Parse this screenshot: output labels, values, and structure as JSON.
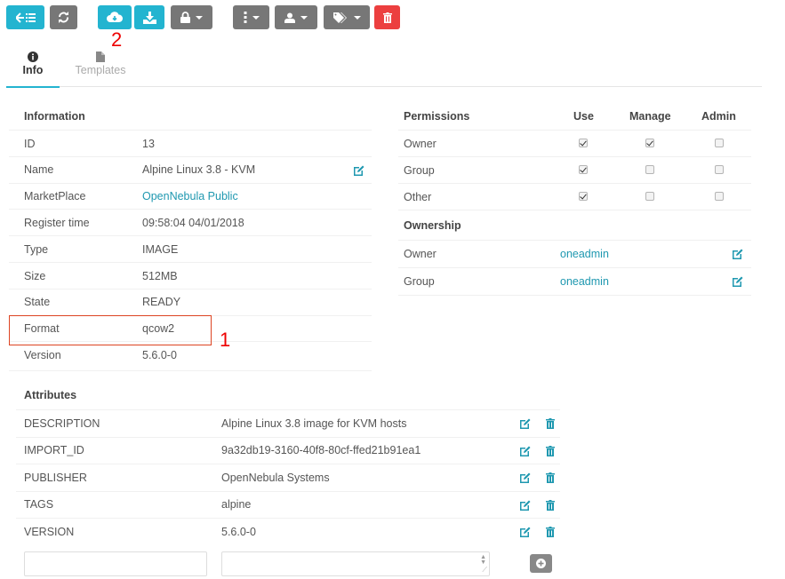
{
  "toolbar": {
    "buttons": [
      {
        "name": "back-to-list",
        "icon": "back-list-icon",
        "color": "#23b4d0"
      },
      {
        "name": "refresh",
        "icon": "refresh-icon",
        "color": "#777777"
      },
      {
        "name": "import",
        "icon": "cloud-download-icon",
        "color": "#23b4d0"
      },
      {
        "name": "download",
        "icon": "download-icon",
        "color": "#23b4d0"
      },
      {
        "name": "lock",
        "icon": "lock-icon",
        "color": "#777777",
        "dropdown": true
      },
      {
        "name": "more-actions",
        "icon": "vertical-ellipsis-icon",
        "color": "#777777",
        "dropdown": true
      },
      {
        "name": "user-actions",
        "icon": "user-icon",
        "color": "#777777",
        "dropdown": true
      },
      {
        "name": "labels",
        "icon": "tags-icon",
        "color": "#777777",
        "dropdown": true
      },
      {
        "name": "delete",
        "icon": "trash-icon",
        "color": "#ec3f3f"
      }
    ]
  },
  "annotations": {
    "marker_1": "1",
    "marker_2": "2"
  },
  "tabs": [
    {
      "label": "Info",
      "icon": "info-circle-icon",
      "active": true
    },
    {
      "label": "Templates",
      "icon": "file-icon",
      "active": false
    }
  ],
  "information": {
    "title": "Information",
    "rows": [
      {
        "label": "ID",
        "value": "13"
      },
      {
        "label": "Name",
        "value": "Alpine Linux 3.8 - KVM",
        "editable": true
      },
      {
        "label": "MarketPlace",
        "value": "OpenNebula Public",
        "link": true
      },
      {
        "label": "Register time",
        "value": "09:58:04 04/01/2018"
      },
      {
        "label": "Type",
        "value": "IMAGE"
      },
      {
        "label": "Size",
        "value": "512MB"
      },
      {
        "label": "State",
        "value": "READY"
      },
      {
        "label": "Format",
        "value": "qcow2"
      },
      {
        "label": "Version",
        "value": "5.6.0-0"
      }
    ]
  },
  "permissions": {
    "title": "Permissions",
    "columns": [
      "Use",
      "Manage",
      "Admin"
    ],
    "rows": [
      {
        "label": "Owner",
        "use": true,
        "manage": true,
        "admin": false
      },
      {
        "label": "Group",
        "use": true,
        "manage": false,
        "admin": false
      },
      {
        "label": "Other",
        "use": true,
        "manage": false,
        "admin": false
      }
    ]
  },
  "ownership": {
    "title": "Ownership",
    "rows": [
      {
        "label": "Owner",
        "value": "oneadmin"
      },
      {
        "label": "Group",
        "value": "oneadmin"
      }
    ]
  },
  "attributes": {
    "title": "Attributes",
    "rows": [
      {
        "key": "DESCRIPTION",
        "value": "Alpine Linux 3.8 image for KVM hosts"
      },
      {
        "key": "IMPORT_ID",
        "value": "9a32db19-3160-40f8-80cf-ffed21b91ea1"
      },
      {
        "key": "PUBLISHER",
        "value": "OpenNebula Systems"
      },
      {
        "key": "TAGS",
        "value": "alpine"
      },
      {
        "key": "VERSION",
        "value": "5.6.0-0"
      }
    ],
    "new_key_value": "",
    "new_value_value": ""
  }
}
